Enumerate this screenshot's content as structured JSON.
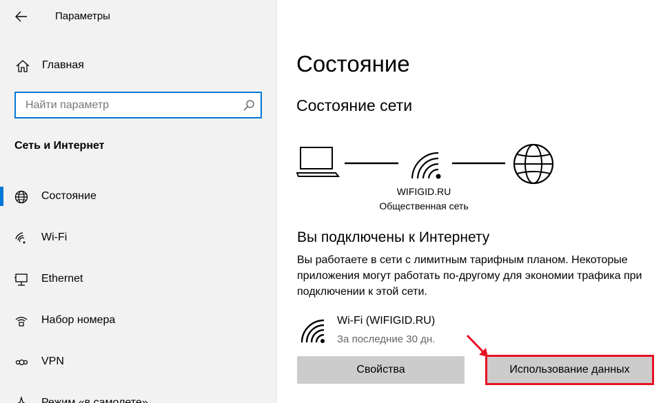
{
  "window": {
    "title": "Параметры"
  },
  "sidebar": {
    "home_label": "Главная",
    "search": {
      "placeholder": "Найти параметр"
    },
    "section_title": "Сеть и Интернет",
    "items": [
      {
        "label": "Состояние",
        "icon": "globe-icon",
        "active": true
      },
      {
        "label": "Wi-Fi",
        "icon": "wifi-icon"
      },
      {
        "label": "Ethernet",
        "icon": "ethernet-icon"
      },
      {
        "label": "Набор номера",
        "icon": "dialup-icon"
      },
      {
        "label": "VPN",
        "icon": "vpn-icon"
      },
      {
        "label": "Режим «в самолете»",
        "icon": "airplane-icon"
      }
    ]
  },
  "main": {
    "page_title": "Состояние",
    "network_status_title": "Состояние сети",
    "network": {
      "name": "WIFIGID.RU",
      "type": "Общественная сеть"
    },
    "connected_title": "Вы подключены к Интернету",
    "description": "Вы работаете в сети с лимитным тарифным планом. Некоторые приложения могут работать по-другому для экономии трафика при подключении к этой сети.",
    "connection": {
      "name": "Wi-Fi (WIFIGID.RU)",
      "period": "За последние 30 дн."
    },
    "buttons": {
      "properties": "Свойства",
      "data_usage": "Использование данных"
    }
  },
  "colors": {
    "accent": "#0078d7",
    "highlight": "#e81123",
    "button_bg": "#cccccc",
    "sidebar_bg": "#f2f2f2"
  }
}
